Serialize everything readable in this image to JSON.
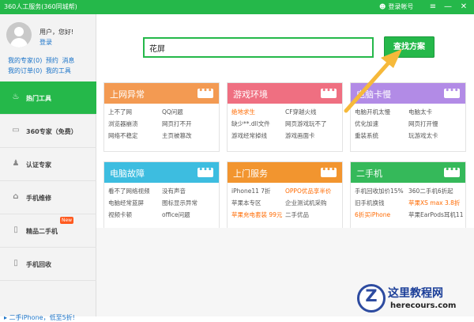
{
  "window": {
    "title": "360人工服务(360同城帮)",
    "login_label": "登录帐号",
    "menu_glyph": "≡",
    "minimize_glyph": "—",
    "close_glyph": "✕"
  },
  "user": {
    "greeting": "用户，您好!",
    "login_link": "登录"
  },
  "quick_links": [
    "我的专家(0)",
    "预约",
    "消息",
    "我的订单(0)",
    "我的工具"
  ],
  "sidebar": {
    "items": [
      {
        "label": "热门工具",
        "icon": "flame-icon",
        "active": true
      },
      {
        "label": "360专家（免费）",
        "icon": "monitor-icon"
      },
      {
        "label": "认证专家",
        "icon": "user-icon"
      },
      {
        "label": "手机维修",
        "icon": "home-icon"
      },
      {
        "label": "精品二手机",
        "icon": "phone-icon",
        "badge": "New"
      },
      {
        "label": "手机回收",
        "icon": "phone-icon"
      }
    ],
    "promo": "二手iPhone，低至5折!"
  },
  "search": {
    "value": "花屏",
    "button_label": "查找方案"
  },
  "cards": [
    {
      "title": "上网异常",
      "color": "#f39a52",
      "items": [
        {
          "text": "上不了网"
        },
        {
          "text": "QQ问题"
        },
        {
          "text": "浏览器崩溃"
        },
        {
          "text": "网页打不开"
        },
        {
          "text": "网络不稳定"
        },
        {
          "text": "主页被篡改"
        }
      ]
    },
    {
      "title": "游戏环境",
      "color": "#ef6f81",
      "items": [
        {
          "text": "绝地求生",
          "highlight": true
        },
        {
          "text": "CF穿越火线"
        },
        {
          "text": "缺少**.dll文件"
        },
        {
          "text": "网页游戏玩不了"
        },
        {
          "text": "游戏经常掉线"
        },
        {
          "text": "游戏画面卡"
        }
      ]
    },
    {
      "title": "电脑卡慢",
      "color": "#b28be6",
      "items": [
        {
          "text": "电脑开机太慢"
        },
        {
          "text": "电脑太卡"
        },
        {
          "text": "优化加速"
        },
        {
          "text": "网页打开慢"
        },
        {
          "text": "重装系统"
        },
        {
          "text": "玩游戏太卡"
        }
      ]
    },
    {
      "title": "电脑故障",
      "color": "#3dbde0",
      "items": [
        {
          "text": "看不了网络视频"
        },
        {
          "text": "没有声音"
        },
        {
          "text": "电脑经常蓝屏"
        },
        {
          "text": "图标显示异常"
        },
        {
          "text": "视频卡顿"
        },
        {
          "text": "office问题"
        }
      ]
    },
    {
      "title": "上门服务",
      "color": "#f2952f",
      "items": [
        {
          "text": "iPhone11 7折"
        },
        {
          "text": "OPPO优品享半价",
          "highlight": true
        },
        {
          "text": "苹果本专区"
        },
        {
          "text": "企业测试机采购"
        },
        {
          "text": "苹果充电套装 99元",
          "highlight": true
        },
        {
          "text": "二手优品"
        }
      ]
    },
    {
      "title": "二手机",
      "color": "#35b95a",
      "items": [
        {
          "text": "手机回收加价15%"
        },
        {
          "text": "360二手机6折起"
        },
        {
          "text": "旧手机换钱"
        },
        {
          "text": "苹果XS max 3.8折",
          "highlight": true
        },
        {
          "text": "6折买iPhone",
          "highlight": true
        },
        {
          "text": "苹果EarPods耳机11"
        }
      ]
    }
  ],
  "watermark": {
    "text": "这里教程网",
    "url": "herecours.com"
  }
}
